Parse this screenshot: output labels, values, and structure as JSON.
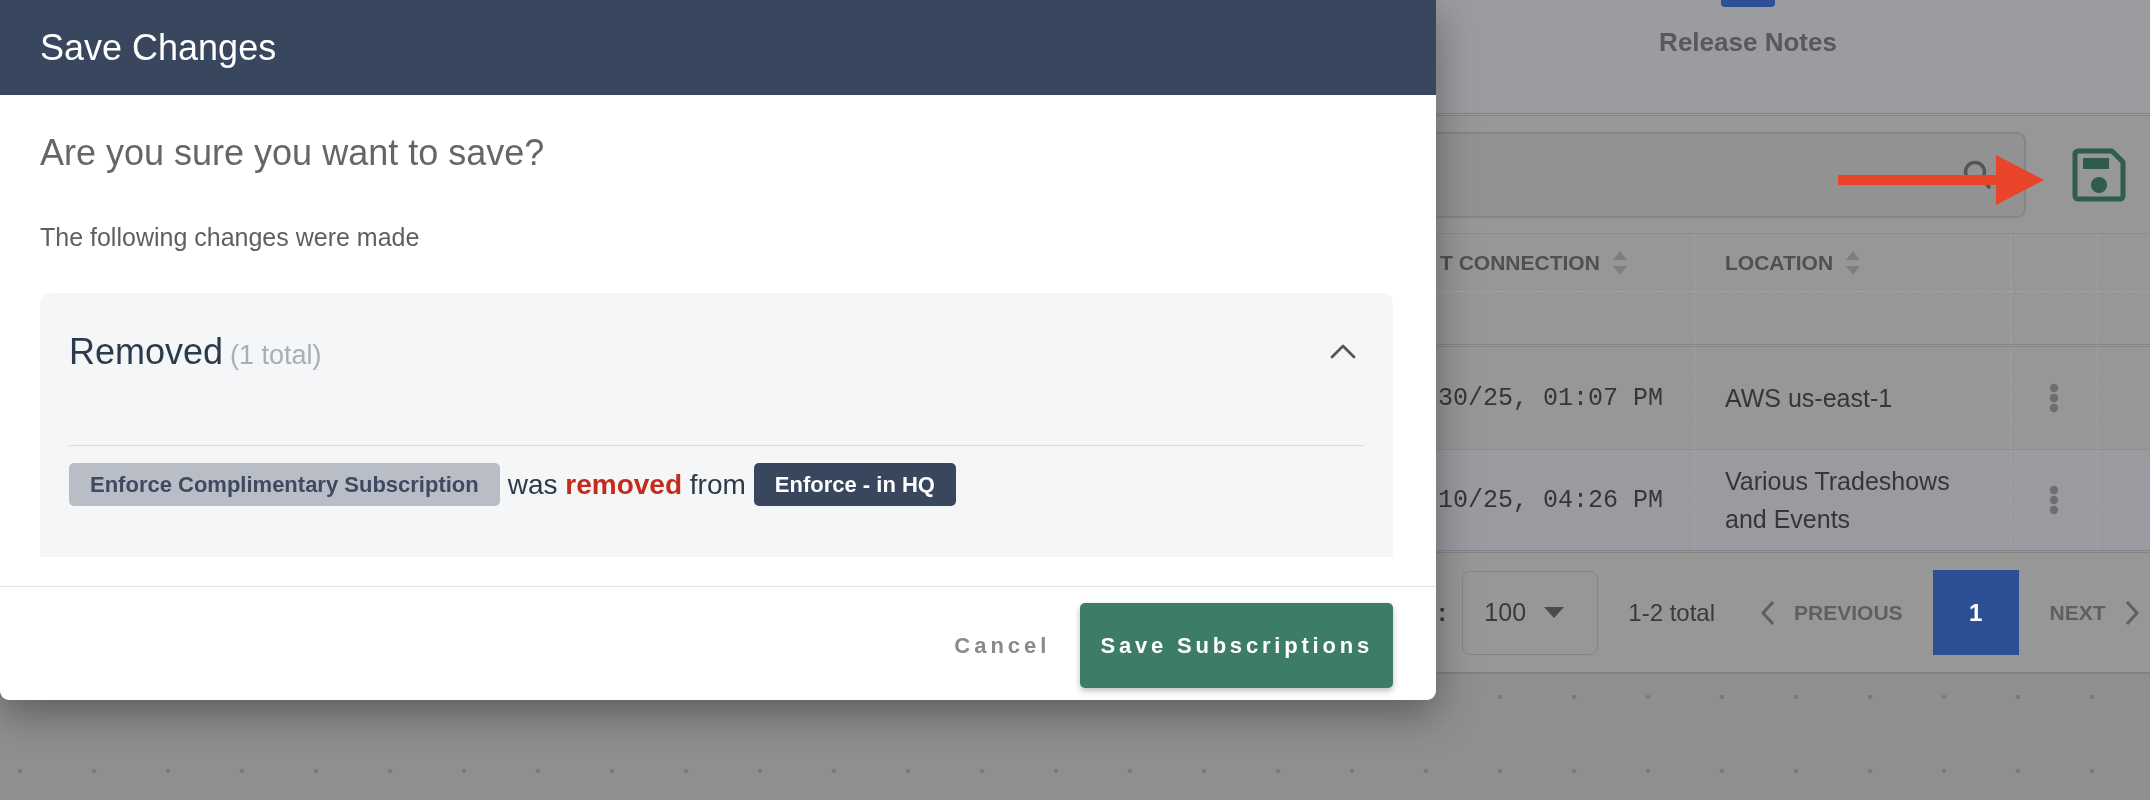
{
  "modal": {
    "title": "Save Changes",
    "question": "Are you sure you want to save?",
    "intro": "The following changes were made",
    "sections": [
      {
        "title": "Removed",
        "count": "(1 total)",
        "expanded": true,
        "changes": [
          {
            "item": "Enforce Complimentary Subscription",
            "description": "was **removed** from",
            "target": "Enforce - in HQ"
          }
        ]
      }
    ],
    "buttons": [
      {
        "label": "Cancel",
        "kind": "text"
      },
      {
        "label": "Save Subscriptions",
        "kind": "primary"
      }
    ]
  },
  "background": {
    "tabs": [
      {
        "label": "Release Notes"
      }
    ],
    "table": {
      "columns": [
        {
          "label": "T CONNECTION"
        },
        {
          "label": "LOCATION"
        }
      ],
      "rows": [
        {
          "cells": [
            "30/25, 01:07 PM",
            "AWS us-east-1"
          ]
        },
        {
          "cells": [
            "10/25, 04:26 PM",
            "Various Tradeshows and Events"
          ]
        }
      ]
    },
    "pagination": {
      "page_size_label": ":",
      "page_size": "100",
      "total": "1-2 total",
      "previous": {
        "label": "PREVIOUS",
        "disabled": true
      },
      "pages": [
        {
          "label": "1",
          "selected": true
        }
      ],
      "next": {
        "label": "NEXT",
        "disabled": true
      }
    }
  }
}
